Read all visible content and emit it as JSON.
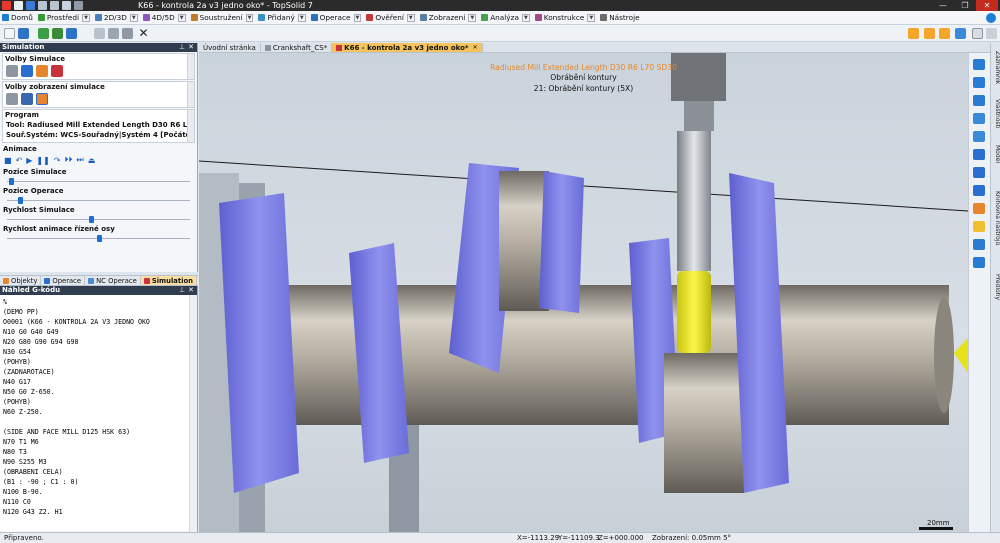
{
  "window": {
    "title": "K66 - kontrola 2a v3 jedno oko* - TopSolid 7"
  },
  "menu": [
    {
      "label": "Domů",
      "color": "#1d7fd4"
    },
    {
      "label": "Prostředí",
      "color": "#3a9a3a"
    },
    {
      "label": "2D/3D",
      "color": "#4a7fc0"
    },
    {
      "label": "4D/5D",
      "color": "#8a5ac0"
    },
    {
      "label": "Soustružení",
      "color": "#c07a2a"
    },
    {
      "label": "Přidaný",
      "color": "#3a8fbf"
    },
    {
      "label": "Operace",
      "color": "#2a70c0"
    },
    {
      "label": "Ověření",
      "color": "#c03a3a"
    },
    {
      "label": "Zobrazení",
      "color": "#5a7fa0"
    },
    {
      "label": "Analýza",
      "color": "#4aa04a"
    },
    {
      "label": "Konstrukce",
      "color": "#a04a8a"
    },
    {
      "label": "Nástroje",
      "color": "#6a6a6a"
    }
  ],
  "simulation_panel": {
    "title": "Simulation",
    "volby_simulace": "Volby Simulace",
    "volby_zobrazeni": "Volby zobrazení simulace",
    "program_label": "Program",
    "tool_line": "Tool: Radiused Mill Extended Length D30 R6 L70 SD30",
    "coord_line": "Souř.Systém: WCS-Souřadný|Systém 4 [Počátek 2 | B1 : 0 ...",
    "animace": "Animace",
    "sliders": [
      {
        "label": "Pozice Simulace",
        "value": 0.02
      },
      {
        "label": "Pozice Operace",
        "value": 0.07
      },
      {
        "label": "Rychlost Simulace",
        "value": 0.46
      },
      {
        "label": "Rychlost animace řízené osy",
        "value": 0.5
      }
    ]
  },
  "bottom_tabs": [
    {
      "label": "Objekty",
      "active": false
    },
    {
      "label": "Operace",
      "active": false
    },
    {
      "label": "NC Operace",
      "active": false
    },
    {
      "label": "Simulation",
      "active": true
    }
  ],
  "gcode_panel": {
    "title": "Náhled G-kódu",
    "lines": [
      "%",
      "(DEMO PP)",
      "O0001 (K66 - KONTROLA 2A V3 JEDNO OKO",
      "N10 G0 G40 G49",
      "N20 G80 G90 G94 G98",
      "N30 G54",
      "(POHYB)",
      "(ZADNAROTACE)",
      "N40 G17",
      "N50 G0 Z-650.",
      "(POHYB)",
      "N60 Z-250.",
      "",
      "(SIDE AND FACE MILL D125 HSK 63)",
      "N70 T1 M6",
      "N80 T3",
      "N90 S255 M3",
      "(OBRABENI CELA)",
      "(B1 : -90 ; C1 : 0)",
      "N100 B-90.",
      "N110 C0",
      "N120 G43 Z2. H1"
    ]
  },
  "doc_tabs": [
    {
      "label": "Úvodní stránka",
      "active": false
    },
    {
      "label": "Crankshaft_CS*",
      "active": false
    },
    {
      "label": "K66 - kontrola 2a v3 jedno oko*",
      "active": true
    }
  ],
  "viewport": {
    "tool_label": "Radiused Mill Extended Length D30 R6 L70 SD30",
    "operation_label": "Obrábění kontury",
    "operation_detail": "21: Obrábění kontury (5X)",
    "scale_label": "20mm",
    "colors": {
      "crank_web": "#7d7fe0",
      "journal": "#b9b2a6",
      "tool_tip": "#f2ee1e",
      "label_orange": "#e8882a"
    }
  },
  "side_tabs": [
    "Záznamník",
    "Vlastnosti",
    "Model",
    "Knihovna nástrojů",
    "Předlohy"
  ],
  "status": {
    "left": "Připraveno.",
    "x": "X=-1113.29",
    "y": "Y=-11109.3",
    "z": "Z=+000.000",
    "zoom": "Zobrazení: 0.05mm 5°"
  }
}
